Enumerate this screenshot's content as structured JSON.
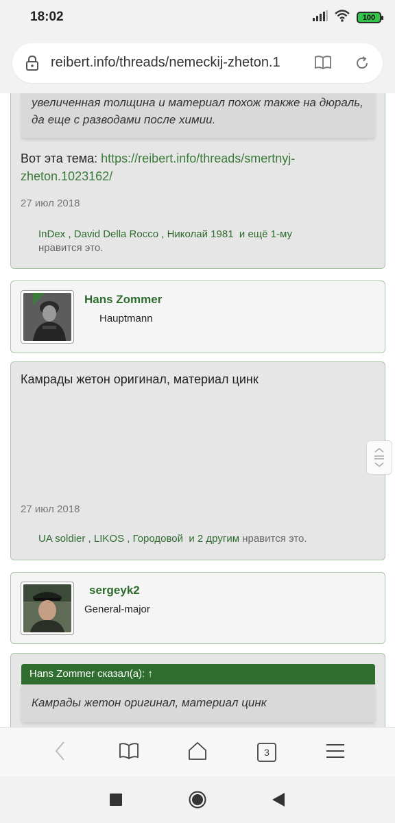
{
  "status": {
    "time": "18:02",
    "battery": "100"
  },
  "browser": {
    "url": "reibert.info/threads/nemeckij-zheton.1",
    "tab_count": "3"
  },
  "post1": {
    "quote_line1": "увеличенная толщина и материал похож также на дюраль,",
    "quote_line2": "да еще с разводами после химии.",
    "text_prefix": "Вот эта тема: ",
    "link_line1": "https://reibert.info/threads/smertnyj-",
    "link_line2": "zheton.1023162/",
    "date": "27 июл 2018",
    "likes": {
      "user1": "InDex",
      "user2": ", David Della Rocco",
      "user3": ", Николай 1981",
      "and_more": "и ещё 1-му",
      "suffix": "нравится это."
    }
  },
  "user1": {
    "name": "Hans Zommer",
    "rank": "Hauptmann"
  },
  "post2": {
    "text": "Камрады жетон оригинал, материал цинк",
    "date": "27 июл 2018",
    "likes": {
      "user1": "UA soldier",
      "user2": ", LIKOS",
      "user3": ", Городовой",
      "and_more": "и 2 другим",
      "suffix": "нравится это."
    }
  },
  "user2": {
    "name": "sergeyk2",
    "rank": "General-major"
  },
  "post3": {
    "quote_header": "Hans Zommer сказал(а): ↑",
    "quote_text": "Камрады жетон оригинал, материал цинк"
  },
  "colors": {
    "accent_green": "#2f6e2f",
    "link_green": "#3a7a3a",
    "border": "#a9c4a9"
  },
  "icons": [
    "signal-icon",
    "wifi-icon",
    "battery-icon",
    "lock-icon",
    "reader-mode-icon",
    "reload-icon",
    "back-icon",
    "bookmarks-icon",
    "home-icon",
    "tabs-icon",
    "menu-icon",
    "square-nav-icon",
    "circle-nav-icon",
    "triangle-nav-icon"
  ]
}
